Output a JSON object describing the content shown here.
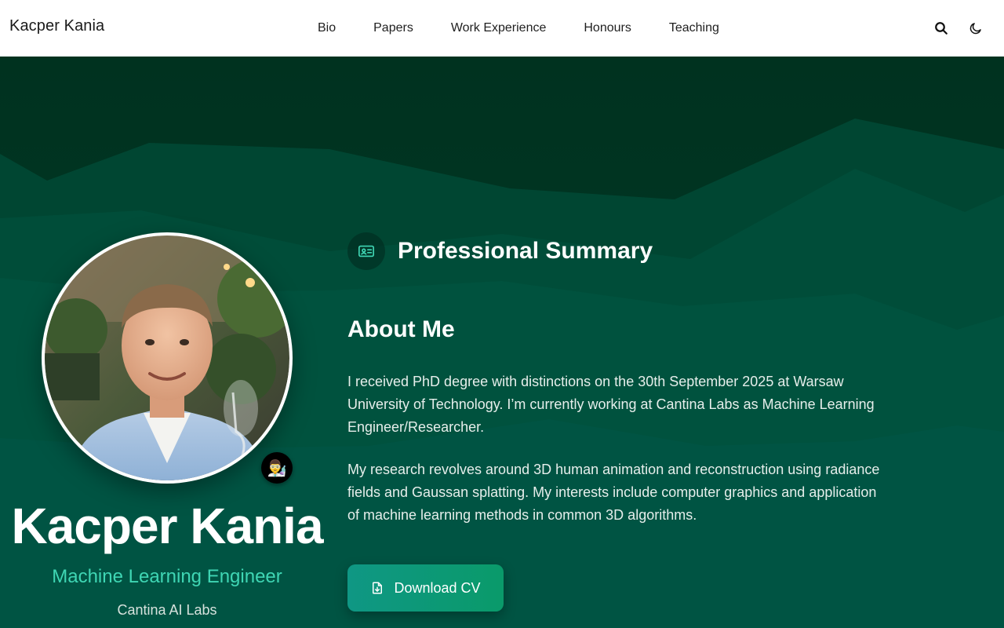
{
  "header": {
    "brand": "Kacper Kania",
    "nav": [
      {
        "label": "Bio"
      },
      {
        "label": "Papers"
      },
      {
        "label": "Work Experience"
      },
      {
        "label": "Honours"
      },
      {
        "label": "Teaching"
      }
    ],
    "icons": {
      "search": "search-icon",
      "theme": "moon-icon"
    }
  },
  "profile": {
    "name": "Kacper Kania",
    "role": "Machine Learning Engineer",
    "organization": "Cantina AI Labs",
    "status_emoji": "👨‍🔬"
  },
  "summary": {
    "section_title": "Professional Summary",
    "section_icon": "id-card-icon",
    "about_heading": "About Me",
    "paragraphs": [
      "I received PhD degree with distinctions on the 30th September 2025 at Warsaw University of Technology. I’m currently working at Cantina Labs as Machine Learning Engineer/Researcher.",
      "My research revolves around 3D human animation and reconstruction using radiance fields and Gaussan splatting. My interests include computer graphics and application of machine learning methods in common 3D algorithms."
    ],
    "cv_button_label": "Download CV",
    "cv_button_icon": "file-download-icon"
  },
  "colors": {
    "accent": "#3fd6b4",
    "hero_dark": "#003826",
    "hero_mid": "#00533f",
    "button": "#0f9784"
  }
}
